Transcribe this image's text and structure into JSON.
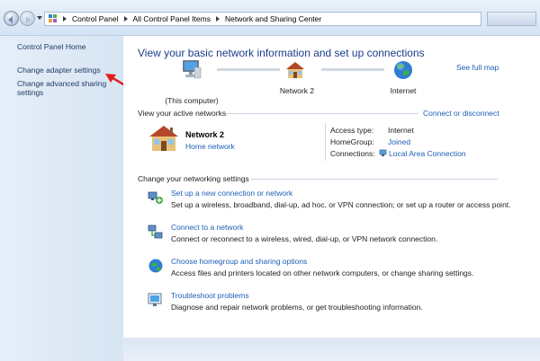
{
  "address_bar": {
    "breadcrumbs": [
      "Control Panel",
      "All Control Panel Items",
      "Network and Sharing Center"
    ]
  },
  "sidebar": {
    "home": "Control Panel Home",
    "links": [
      "Change adapter settings",
      "Change advanced sharing settings"
    ]
  },
  "main": {
    "heading": "View your basic network information and set up connections",
    "see_full_map": "See full map",
    "map": {
      "computer_label": "(This computer)",
      "network_label": "Network  2",
      "internet_label": "Internet"
    },
    "active_networks": {
      "title": "View your active networks",
      "connect_link": "Connect or disconnect",
      "network_name": "Network  2",
      "network_type": "Home network",
      "access_type_label": "Access type:",
      "access_type_value": "Internet",
      "homegroup_label": "HomeGroup:",
      "homegroup_value": "Joined",
      "connections_label": "Connections:",
      "connections_value": "Local Area Connection"
    },
    "settings": {
      "title": "Change your networking settings",
      "tasks": [
        {
          "link": "Set up a new connection or network",
          "desc": "Set up a wireless, broadband, dial-up, ad hoc, or VPN connection; or set up a router or access point."
        },
        {
          "link": "Connect to a network",
          "desc": "Connect or reconnect to a wireless, wired, dial-up, or VPN network connection."
        },
        {
          "link": "Choose homegroup and sharing options",
          "desc": "Access files and printers located on other network computers, or change sharing settings."
        },
        {
          "link": "Troubleshoot problems",
          "desc": "Diagnose and repair network problems, or get troubleshooting information."
        }
      ]
    }
  },
  "colors": {
    "link": "#1c5fb5",
    "heading": "#1a3e8a",
    "annotation_arrow": "#e0201c"
  }
}
